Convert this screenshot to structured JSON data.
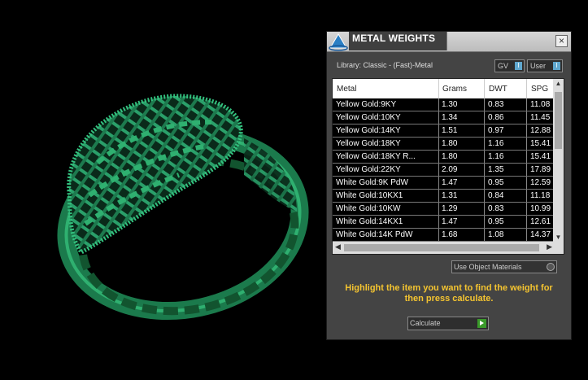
{
  "window": {
    "title": "METAL WEIGHTS",
    "close_label": "×"
  },
  "library_label": "Library: Classic - (Fast)-Metal",
  "toggles": [
    {
      "label": "GV",
      "state": "I"
    },
    {
      "label": "User",
      "state": "I"
    }
  ],
  "table": {
    "columns": [
      "Metal",
      "Grams",
      "DWT",
      "SPG"
    ],
    "rows": [
      [
        "Yellow Gold:9KY",
        "1.30",
        "0.83",
        "11.08"
      ],
      [
        "Yellow Gold:10KY",
        "1.34",
        "0.86",
        "11.45"
      ],
      [
        "Yellow Gold:14KY",
        "1.51",
        "0.97",
        "12.88"
      ],
      [
        "Yellow Gold:18KY",
        "1.80",
        "1.16",
        "15.41"
      ],
      [
        "Yellow Gold:18KY R...",
        "1.80",
        "1.16",
        "15.41"
      ],
      [
        "Yellow Gold:22KY",
        "2.09",
        "1.35",
        "17.89"
      ],
      [
        "White Gold:9K PdW",
        "1.47",
        "0.95",
        "12.59"
      ],
      [
        "White Gold:10KX1",
        "1.31",
        "0.84",
        "11.18"
      ],
      [
        "White Gold:10KW",
        "1.29",
        "0.83",
        "10.99"
      ],
      [
        "White Gold:14KX1",
        "1.47",
        "0.95",
        "12.61"
      ],
      [
        "White Gold:14K PdW",
        "1.68",
        "1.08",
        "14.37"
      ]
    ]
  },
  "materials_dropdown": "Use Object Materials",
  "hint": "Highlight the item you want to find the weight for then press calculate.",
  "calculate_label": "Calculate",
  "colors": {
    "ring": "#1f8a57",
    "accent": "#f4c430",
    "panel": "#444444"
  }
}
